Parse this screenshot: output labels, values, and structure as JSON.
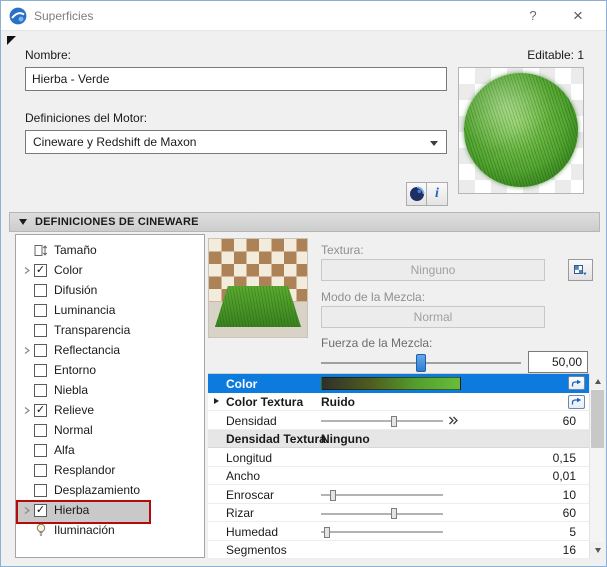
{
  "window": {
    "title": "Superficies",
    "help_label": "?",
    "close_label": "×"
  },
  "fields": {
    "nombre_label": "Nombre:",
    "editable_label": "Editable: 1",
    "nombre_value": "Hierba - Verde",
    "motor_label": "Definiciones del Motor:",
    "motor_value": "Cineware y Redshift de Maxon",
    "info_label": "i"
  },
  "section": {
    "header": "DEFINICIONES DE CINEWARE"
  },
  "tree": {
    "items": [
      {
        "label": "Tamaño",
        "control": "icon",
        "icon": "size-icon"
      },
      {
        "label": "Color",
        "control": "checkbox",
        "checked": true,
        "expander": true
      },
      {
        "label": "Difusión",
        "control": "checkbox",
        "checked": false
      },
      {
        "label": "Luminancia",
        "control": "checkbox",
        "checked": false
      },
      {
        "label": "Transparencia",
        "control": "checkbox",
        "checked": false
      },
      {
        "label": "Reflectancia",
        "control": "checkbox",
        "checked": false,
        "expander": true
      },
      {
        "label": "Entorno",
        "control": "checkbox",
        "checked": false
      },
      {
        "label": "Niebla",
        "control": "checkbox",
        "checked": false
      },
      {
        "label": "Relieve",
        "control": "checkbox",
        "checked": true,
        "expander": true
      },
      {
        "label": "Normal",
        "control": "checkbox",
        "checked": false
      },
      {
        "label": "Alfa",
        "control": "checkbox",
        "checked": false
      },
      {
        "label": "Resplandor",
        "control": "checkbox",
        "checked": false
      },
      {
        "label": "Desplazamiento",
        "control": "checkbox",
        "checked": false
      },
      {
        "label": "Hierba",
        "control": "checkbox",
        "checked": true,
        "expander": true,
        "selected": true
      },
      {
        "label": "Iluminación",
        "control": "icon",
        "icon": "bulb-icon"
      }
    ]
  },
  "cineware": {
    "textura_label": "Textura:",
    "textura_value": "Ninguno",
    "modo_label": "Modo de la Mezcla:",
    "modo_value": "Normal",
    "fuerza_label": "Fuerza de la Mezcla:",
    "fuerza_value": "50,00",
    "fuerza_percent": 50
  },
  "properties": {
    "rows": [
      {
        "label": "Color",
        "type": "gradient",
        "selected": true,
        "bold": true,
        "right_icon": true
      },
      {
        "label": "Color Textura",
        "type": "text",
        "value": "Ruido",
        "bold": true,
        "expander": true,
        "right_icon": true
      },
      {
        "label": "Densidad",
        "type": "slider",
        "percent": 60,
        "value": "60",
        "flag_icon": true
      },
      {
        "label": "Densidad Textura",
        "type": "text",
        "value": "Ninguno",
        "bold": true,
        "subheader": true
      },
      {
        "label": "Longitud",
        "type": "value",
        "value": "0,15"
      },
      {
        "label": "Ancho",
        "type": "value",
        "value": "0,01"
      },
      {
        "label": "Enroscar",
        "type": "slider",
        "percent": 10,
        "value": "10"
      },
      {
        "label": "Rizar",
        "type": "slider",
        "percent": 60,
        "value": "60"
      },
      {
        "label": "Humedad",
        "type": "slider",
        "percent": 5,
        "value": "5"
      },
      {
        "label": "Segmentos",
        "type": "value",
        "value": "16"
      }
    ]
  },
  "colors": {
    "selection_blue": "#0d7bdd",
    "highlight_red": "#b40b0b",
    "grass_green": "#4e9a2e",
    "gradient": [
      "#30302a",
      "#4f5c1e",
      "#55a02f",
      "#68bc3a"
    ]
  }
}
